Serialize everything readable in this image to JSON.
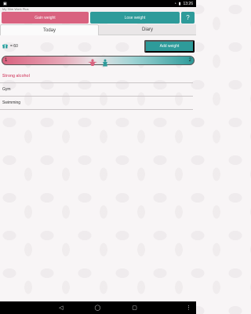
{
  "status_bar": {
    "time": "13:26",
    "left_icon": "android-debug-icon",
    "wifi_icon": "wifi-icon",
    "battery_icon": "battery-icon"
  },
  "app": {
    "title": "My Slim Work Plus"
  },
  "top_buttons": {
    "gain": "Gain weight",
    "lose": "Lose weight",
    "help": "?"
  },
  "tabs": [
    {
      "label": "Today",
      "active": true
    },
    {
      "label": "Diary",
      "active": false
    }
  ],
  "counter": {
    "value": "= 60",
    "icon": "gift-icon"
  },
  "add_weight": "Add weight",
  "progress": {
    "left": "1",
    "right": "2"
  },
  "activities": [
    {
      "label": "Strong alcohol",
      "highlight": true
    },
    {
      "label": "Gym",
      "highlight": false
    },
    {
      "label": "Swimming",
      "highlight": false
    }
  ],
  "nav": {
    "back_icon": "back-icon",
    "home_icon": "home-icon",
    "recent_icon": "recent-apps-icon",
    "menu_icon": "overflow-menu-icon"
  },
  "colors": {
    "pink": "#d9627f",
    "teal": "#2e9b9a"
  }
}
